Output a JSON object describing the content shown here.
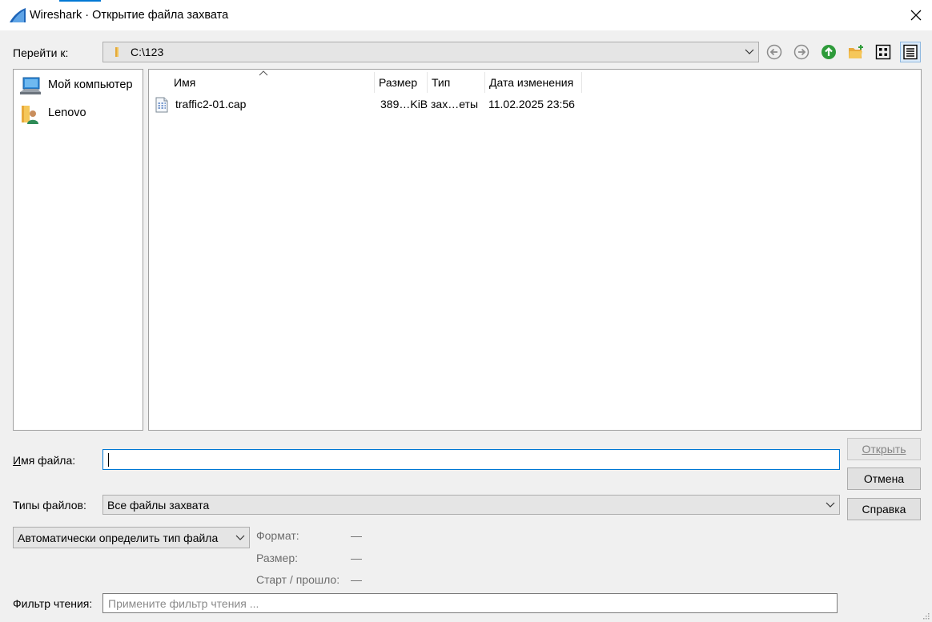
{
  "window": {
    "title": "Wireshark · Открытие файла захвата",
    "app_icon": "wireshark-fin-icon",
    "close_icon": "close-icon"
  },
  "nav": {
    "goto_label": "Перейти к:",
    "path": "C:\\123",
    "buttons": [
      "back-icon",
      "forward-icon",
      "parent-folder-icon",
      "new-folder-icon",
      "list-view-icon",
      "detail-view-icon"
    ]
  },
  "sidebar": {
    "items": [
      {
        "label": "Мой компьютер",
        "icon": "computer-icon"
      },
      {
        "label": "Lenovo",
        "icon": "user-folder-icon"
      }
    ]
  },
  "filelist": {
    "columns": [
      "Имя",
      "Размер",
      "Тип",
      "Дата изменения"
    ],
    "rows": [
      {
        "name": "traffic2-01.cap",
        "size": "389…KiB",
        "type": "зах…еты",
        "modified": "11.02.2025 23:56",
        "icon": "capture-file-icon"
      }
    ]
  },
  "form": {
    "filename_label": "Имя файла:",
    "filename_value": "",
    "filetypes_label": "Типы файлов:",
    "filetypes_value": "Все файлы захвата",
    "format_detect_value": "Автоматически определить тип файла",
    "read_filter_label": "Фильтр чтения:",
    "read_filter_placeholder": "Примените фильтр чтения ..."
  },
  "info": {
    "format_label": "Формат:",
    "format_value": "—",
    "size_label": "Размер:",
    "size_value": "—",
    "start_label": "Старт / прошло:",
    "start_value": "—"
  },
  "buttons": {
    "open": "Открыть",
    "cancel": "Отмена",
    "help": "Справка"
  },
  "colors": {
    "accent": "#0078d4",
    "folder": "#f2c55c",
    "up_arrow": "#2e9b3a"
  }
}
